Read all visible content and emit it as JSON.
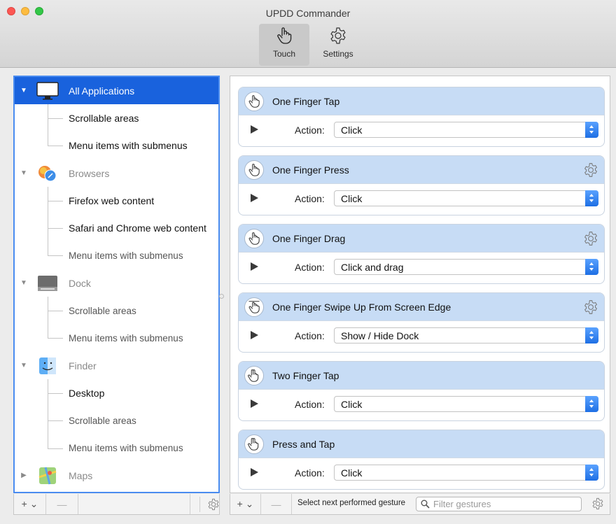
{
  "window": {
    "title": "UPDD Commander"
  },
  "toolbar": {
    "touch_label": "Touch",
    "settings_label": "Settings"
  },
  "tree": {
    "groups": [
      {
        "label": "All Applications",
        "icon": "monitor-icon",
        "selected": true,
        "expanded": true,
        "children": [
          {
            "label": "Scrollable areas",
            "style": "bold"
          },
          {
            "label": "Menu items with submenus",
            "style": "bold"
          }
        ]
      },
      {
        "label": "Browsers",
        "icon": "browsers-icon",
        "selected": false,
        "expanded": true,
        "children": [
          {
            "label": "Firefox web content",
            "style": "bold"
          },
          {
            "label": "Safari and Chrome web content",
            "style": "bold"
          },
          {
            "label": "Menu items with submenus",
            "style": "dim"
          }
        ]
      },
      {
        "label": "Dock",
        "icon": "dock-icon",
        "selected": false,
        "expanded": true,
        "children": [
          {
            "label": "Scrollable areas",
            "style": "dim"
          },
          {
            "label": "Menu items with submenus",
            "style": "dim"
          }
        ]
      },
      {
        "label": "Finder",
        "icon": "finder-icon",
        "selected": false,
        "expanded": true,
        "children": [
          {
            "label": "Desktop",
            "style": "bold"
          },
          {
            "label": "Scrollable areas",
            "style": "dim"
          },
          {
            "label": "Menu items with submenus",
            "style": "dim"
          }
        ]
      },
      {
        "label": "Maps",
        "icon": "maps-icon",
        "selected": false,
        "expanded": false,
        "children": []
      }
    ]
  },
  "left_bottom": {
    "add_label": "+ ⌄",
    "remove_label": "—"
  },
  "gestures": [
    {
      "title": "One Finger Tap",
      "icon": "one-finger-tap-icon",
      "has_gear": false,
      "action_label": "Action:",
      "action_value": "Click"
    },
    {
      "title": "One Finger Press",
      "icon": "one-finger-press-icon",
      "has_gear": true,
      "action_label": "Action:",
      "action_value": "Click"
    },
    {
      "title": "One Finger Drag",
      "icon": "one-finger-drag-icon",
      "has_gear": true,
      "action_label": "Action:",
      "action_value": "Click and drag"
    },
    {
      "title": "One Finger Swipe Up From Screen Edge",
      "icon": "swipe-up-edge-icon",
      "has_gear": true,
      "action_label": "Action:",
      "action_value": "Show / Hide Dock"
    },
    {
      "title": "Two Finger Tap",
      "icon": "two-finger-tap-icon",
      "has_gear": false,
      "action_label": "Action:",
      "action_value": "Click"
    },
    {
      "title": "Press and Tap",
      "icon": "press-and-tap-icon",
      "has_gear": false,
      "action_label": "Action:",
      "action_value": "Click"
    }
  ],
  "right_bottom": {
    "add_label": "+ ⌄",
    "remove_label": "—",
    "next_gesture_label": "Select next performed gesture",
    "filter_placeholder": "Filter gestures"
  },
  "colors": {
    "selection": "#1962dd",
    "card_header": "#c7dcf5",
    "focus_border": "#4a8cf0"
  }
}
